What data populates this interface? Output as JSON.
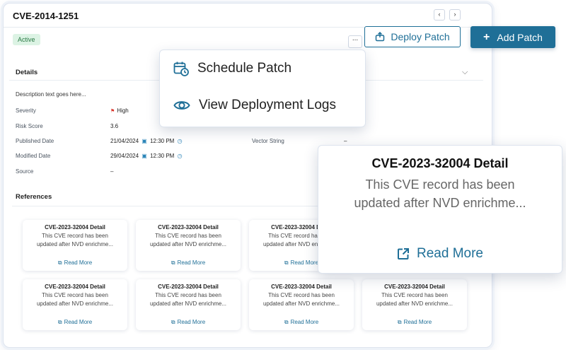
{
  "header": {
    "title": "CVE-2014-1251",
    "prev": "‹",
    "next": "›"
  },
  "status": {
    "label": "Active"
  },
  "more_label": "...",
  "actions": {
    "deploy_label": "Deploy Patch",
    "add_label": "Add Patch"
  },
  "menu": {
    "items": [
      {
        "label": "Schedule Patch"
      },
      {
        "label": "View Deployment Logs"
      }
    ]
  },
  "details": {
    "title": "Details",
    "description": "Description text goes here...",
    "severity": {
      "label": "Severity",
      "value": "High"
    },
    "risk_score": {
      "label": "Risk Score",
      "value": "3.6"
    },
    "published": {
      "label": "Published Date",
      "date": "21/04/2024",
      "time": "12:30 PM"
    },
    "modified": {
      "label": "Modified Date",
      "date": "29/04/2024",
      "time": "12:30 PM"
    },
    "source": {
      "label": "Source",
      "value": "–"
    },
    "vector": {
      "label": "Vector String",
      "value": "–"
    }
  },
  "references": {
    "title": "References",
    "cards": [
      {
        "title": "CVE-2023-32004 Detail",
        "desc1": "This CVE record has been",
        "desc2": "updated after NVD enrichme...",
        "link": "Read More"
      },
      {
        "title": "CVE-2023-32004 Detail",
        "desc1": "This CVE record has been",
        "desc2": "updated after NVD enrichme...",
        "link": "Read More"
      },
      {
        "title": "CVE-2023-32004 Detail",
        "desc1": "This CVE record has been",
        "desc2": "updated after NVD enrichme...",
        "link": "Read More"
      },
      {
        "title": "CVE-2023-32004 Detail",
        "desc1": "This CVE record has been",
        "desc2": "updated after NVD enrichme...",
        "link": "Read More"
      },
      {
        "title": "CVE-2023-32004 Detail",
        "desc1": "This CVE record has been",
        "desc2": "updated after NVD enrichme...",
        "link": "Read More"
      },
      {
        "title": "CVE-2023-32004 Detail",
        "desc1": "This CVE record has been",
        "desc2": "updated after NVD enrichme...",
        "link": "Read More"
      },
      {
        "title": "CVE-2023-32004 Detail",
        "desc1": "This CVE record has been",
        "desc2": "updated after NVD enrichme...",
        "link": "Read More"
      }
    ]
  },
  "popup": {
    "title": "CVE-2023-32004 Detail",
    "desc1": "This CVE record has been",
    "desc2": "updated after NVD enrichme...",
    "link": "Read More"
  },
  "colors": {
    "accent": "#1f6f97",
    "active_badge_bg": "#dcf3e4",
    "active_badge_text": "#2b7a45",
    "severity_flag": "#d9342b"
  },
  "icons": [
    "chevron-left-icon",
    "chevron-right-icon",
    "more-icon",
    "deploy-icon",
    "plus-icon",
    "calendar-clock-icon",
    "eye-icon",
    "chevron-down-icon",
    "flag-icon",
    "calendar-icon",
    "clock-icon",
    "external-link-icon"
  ]
}
